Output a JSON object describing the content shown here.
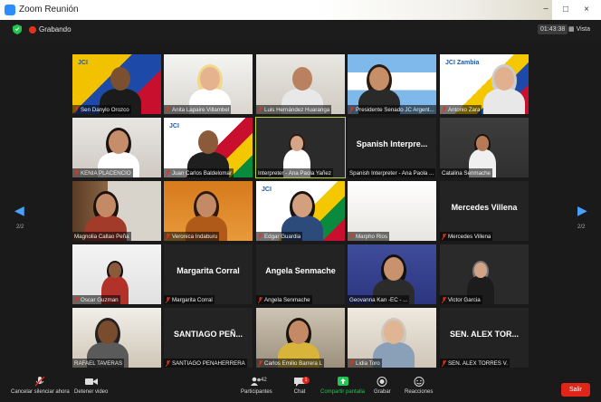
{
  "window": {
    "title": "Zoom Reunión",
    "controls": [
      "−",
      "□",
      "×"
    ]
  },
  "topbar": {
    "recording": "Grabando",
    "timer": "01:43:38",
    "view_label": "Vista"
  },
  "nav": {
    "left_page": "2/2",
    "right_page": "2/2"
  },
  "participants": [
    {
      "name": "Sen Danylo Orozco",
      "big": "",
      "video": true,
      "muted": true
    },
    {
      "name": "Anita Lapaire Villambel",
      "big": "",
      "video": true,
      "muted": true
    },
    {
      "name": "Luis Hernández Huaranga",
      "big": "",
      "video": true,
      "muted": true
    },
    {
      "name": "Presidente Senado JC Argent...",
      "big": "",
      "video": true,
      "muted": true
    },
    {
      "name": "Antonio Zara",
      "big": "",
      "video": true,
      "muted": true
    },
    {
      "name": "KENIA PLACENCIO",
      "big": "",
      "video": true,
      "muted": true
    },
    {
      "name": "Juan Carlos Baldelomar",
      "big": "",
      "video": true,
      "muted": true
    },
    {
      "name": "Interpreter - Ana Paola Yañez",
      "big": "",
      "video": true,
      "muted": false,
      "active": true
    },
    {
      "name": "Spanish Interpreter - Ana Paola ...",
      "big": "Spanish Interpre...",
      "video": false,
      "muted": false
    },
    {
      "name": "Catalina Senmache",
      "big": "",
      "video": true,
      "muted": false
    },
    {
      "name": "Magnolia Callao Peña",
      "big": "",
      "video": true,
      "muted": false
    },
    {
      "name": "Veronica Indaburu",
      "big": "",
      "video": true,
      "muted": true
    },
    {
      "name": "Edgar Guardia",
      "big": "",
      "video": true,
      "muted": true
    },
    {
      "name": "Marpho Rios",
      "big": "",
      "video": true,
      "muted": true
    },
    {
      "name": "Mercedes Villena",
      "big": "Mercedes Villena",
      "video": false,
      "muted": true
    },
    {
      "name": "Oscar Guzman",
      "big": "",
      "video": true,
      "muted": true
    },
    {
      "name": "Margarita Corral",
      "big": "Margarita Corral",
      "video": false,
      "muted": true
    },
    {
      "name": "Angela Senmache",
      "big": "Angela Senmache",
      "video": false,
      "muted": true
    },
    {
      "name": "Geovanna Kan -EC - ...",
      "big": "",
      "video": true,
      "muted": false
    },
    {
      "name": "Victor Garcia",
      "big": "",
      "video": true,
      "muted": true
    },
    {
      "name": "RAFAEL TAVERAS",
      "big": "",
      "video": true,
      "muted": false
    },
    {
      "name": "SANTIAGO PEÑAHERRERA",
      "big": "SANTIAGO PEÑ...",
      "video": false,
      "muted": true
    },
    {
      "name": "Carlos Emilio Barrera L",
      "big": "",
      "video": true,
      "muted": true
    },
    {
      "name": "Lidia Toro",
      "big": "",
      "video": true,
      "muted": true
    },
    {
      "name": "SEN. ALEX TORRES V.",
      "big": "SEN. ALEX TOR...",
      "video": false,
      "muted": true
    }
  ],
  "toolbar": {
    "mute_label": "Cancelar silenciar ahora",
    "video_label": "Detener video",
    "participants_label": "Participantes",
    "participants_count": "42",
    "chat_label": "Chat",
    "chat_badge": "1",
    "share_label": "Compartir pantalla",
    "record_label": "Grabar",
    "reactions_label": "Reacciones",
    "leave_label": "Salir"
  },
  "colors": {
    "active_speaker": "#b7d63b",
    "share_green": "#23c552",
    "leave_red": "#e0251b",
    "accent_blue": "#2d8cff"
  },
  "logos": {
    "jci": "JCI",
    "jci_zambia": "JCI Zambia"
  }
}
